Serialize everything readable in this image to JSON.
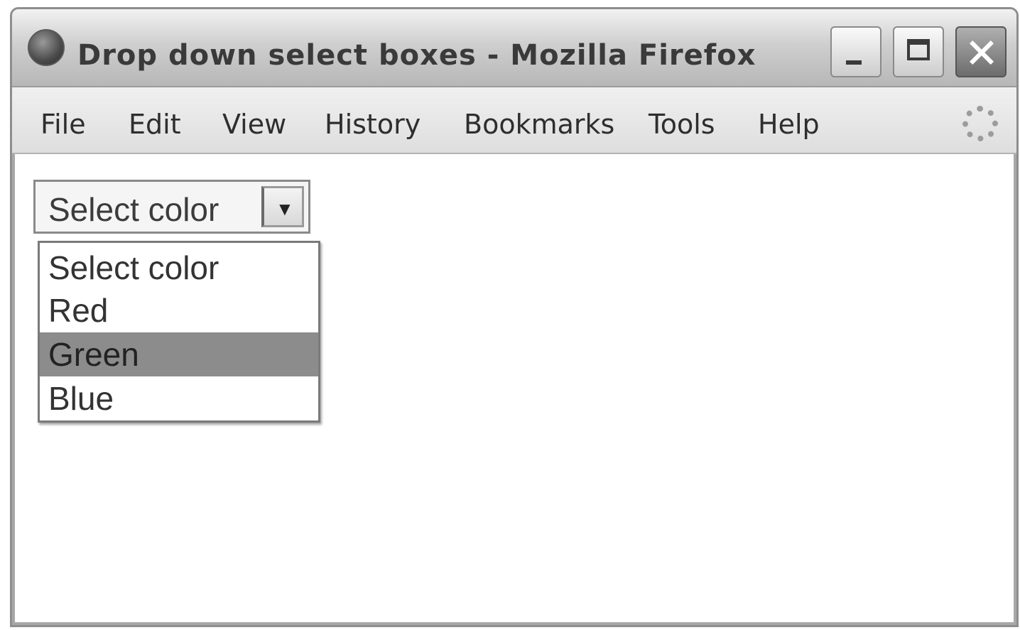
{
  "window": {
    "title": "Drop down select boxes - Mozilla Firefox",
    "icon": "firefox-icon"
  },
  "menubar": {
    "items": [
      "File",
      "Edit",
      "View",
      "History",
      "Bookmarks",
      "Tools",
      "Help"
    ]
  },
  "select": {
    "value": "Select color",
    "options": [
      "Select color",
      "Red",
      "Green",
      "Blue"
    ],
    "highlighted": "Green"
  },
  "colors": {
    "highlight": "#8c8c8c",
    "titlebar": "#cfcfcf",
    "menubar": "#e6e6e6"
  }
}
